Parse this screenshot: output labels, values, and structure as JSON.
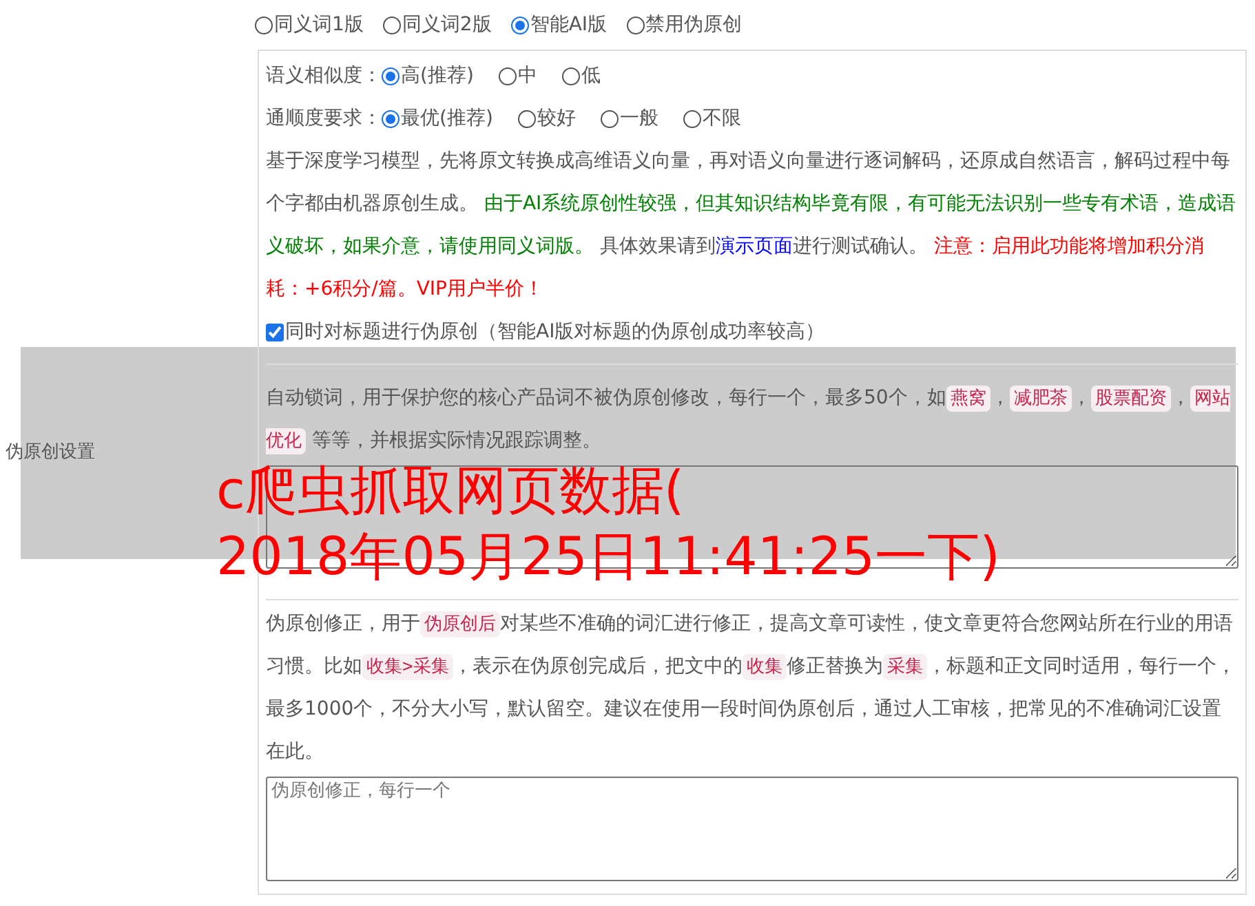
{
  "section_label": "伪原创设置",
  "modes": [
    {
      "label": "同义词1版",
      "selected": false
    },
    {
      "label": "同义词2版",
      "selected": false
    },
    {
      "label": "智能AI版",
      "selected": true
    },
    {
      "label": "禁用伪原创",
      "selected": false
    }
  ],
  "ai_settings": {
    "similarity": {
      "label": "语义相似度：",
      "options": [
        {
          "label": "高(推荐)",
          "selected": true
        },
        {
          "label": "中",
          "selected": false
        },
        {
          "label": "低",
          "selected": false
        }
      ]
    },
    "fluency": {
      "label": "通顺度要求：",
      "options": [
        {
          "label": "最优(推荐)",
          "selected": true
        },
        {
          "label": "较好",
          "selected": false
        },
        {
          "label": "一般",
          "selected": false
        },
        {
          "label": "不限",
          "selected": false
        }
      ]
    },
    "description": [
      {
        "kind": "text",
        "text": "基于深度学习模型，先将原文转换成高维语义向量，再对语义向量进行逐词解码，还原成自然语言，解码过程中每个字都由机器原创生成。 ",
        "color": "#555555"
      },
      {
        "kind": "text",
        "text": "由于AI系统原创性较强，但其知识结构毕竟有限，有可能无法识别一些专有术语，造成语义破坏，如果介意，请使用同义词版。 ",
        "color": "#008000"
      },
      {
        "kind": "text",
        "text": "具体效果请到",
        "color": "#555555"
      },
      {
        "kind": "link",
        "text": "演示页面",
        "color": "#0000ff"
      },
      {
        "kind": "text",
        "text": "进行测试确认。 ",
        "color": "#555555"
      },
      {
        "kind": "text",
        "text": "注意：启用此功能将增加积分消耗：+6积分/篇。VIP用户半价！",
        "color": "#ff0000"
      }
    ],
    "title_option": {
      "label": "同时对标题进行伪原创（智能AI版对标题的伪原创成功率较高）",
      "checked": true
    }
  },
  "lock_words": {
    "description": [
      {
        "kind": "text",
        "text": "自动锁词，用于保护您的核心产品词不被伪原创修改，每行一个，最多50个，如"
      },
      {
        "kind": "tag",
        "text": "燕窝"
      },
      {
        "kind": "text",
        "text": "，"
      },
      {
        "kind": "tag",
        "text": "减肥茶"
      },
      {
        "kind": "text",
        "text": "，"
      },
      {
        "kind": "tag",
        "text": "股票配资"
      },
      {
        "kind": "text",
        "text": "，"
      },
      {
        "kind": "tag",
        "text": "网站优化"
      },
      {
        "kind": "text",
        "text": " 等等，并根据实际情况跟踪调整。"
      }
    ]
  },
  "corrections": {
    "description": [
      {
        "kind": "text",
        "text": "伪原创修正，用于"
      },
      {
        "kind": "tag",
        "text": "伪原创后"
      },
      {
        "kind": "text",
        "text": "对某些不准确的词汇进行修正，提高文章可读性，使文章更符合您网站所在行业的用语习惯。比如"
      },
      {
        "kind": "tag",
        "text": "收集>采集"
      },
      {
        "kind": "text",
        "text": "，表示在伪原创完成后，把文中的"
      },
      {
        "kind": "tag",
        "text": "收集"
      },
      {
        "kind": "text",
        "text": "修正替换为"
      },
      {
        "kind": "tag",
        "text": "采集"
      },
      {
        "kind": "text",
        "text": "，标题和正文同时适用，每行一个，最多1000个，不分大小写，默认留空。建议在使用一段时间伪原创后，通过人工审核，把常见的不准确词汇设置在此。"
      }
    ],
    "placeholder": "伪原创修正，每行一个"
  },
  "overlay": {
    "lines": [
      "c爬虫抓取网页数据(",
      "2018年05月25日11:41:25一下)"
    ]
  }
}
